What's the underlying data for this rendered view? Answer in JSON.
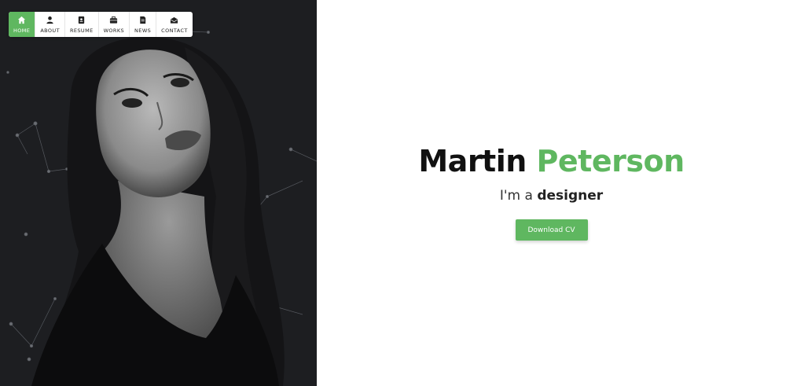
{
  "nav": {
    "items": [
      {
        "label": "HOME",
        "icon": "home-icon",
        "active": true
      },
      {
        "label": "ABOUT",
        "icon": "user-icon",
        "active": false
      },
      {
        "label": "RESUME",
        "icon": "resume-icon",
        "active": false
      },
      {
        "label": "WORKS",
        "icon": "briefcase-icon",
        "active": false
      },
      {
        "label": "NEWS",
        "icon": "news-icon",
        "active": false
      },
      {
        "label": "CONTACT",
        "icon": "envelope-icon",
        "active": false
      }
    ]
  },
  "hero": {
    "first_name": "Martin",
    "last_name": "Peterson",
    "tagline_prefix": "I'm a",
    "role": "designer",
    "cv_button_label": "Download CV"
  },
  "colors": {
    "accent": "#5fb760",
    "photo_background": "#1d1e21",
    "text_dark": "#111111"
  }
}
